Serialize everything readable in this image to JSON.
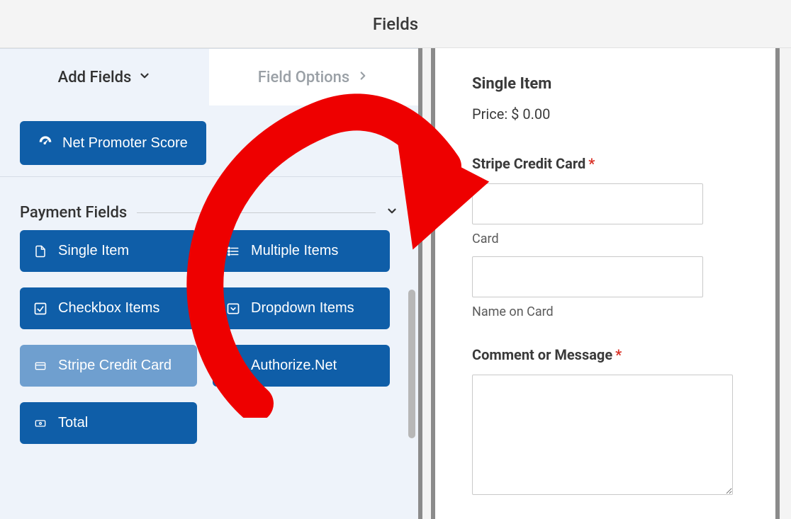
{
  "header": {
    "title": "Fields"
  },
  "tabs": {
    "add_fields": "Add Fields",
    "field_options": "Field Options"
  },
  "top_button": {
    "label": "Net Promoter Score"
  },
  "section": {
    "title": "Payment Fields"
  },
  "payment_fields": {
    "single_item": "Single Item",
    "multiple_items": "Multiple Items",
    "checkbox_items": "Checkbox Items",
    "dropdown_items": "Dropdown Items",
    "stripe_credit_card": "Stripe Credit Card",
    "authorize_net": "Authorize.Net",
    "total": "Total"
  },
  "preview": {
    "item_title": "Single Item",
    "price_label": "Price: $ 0.00",
    "stripe_label": "Stripe Credit Card",
    "card_sub": "Card",
    "name_sub": "Name on Card",
    "comment_label": "Comment or Message"
  },
  "colors": {
    "accent": "#0f5ea8",
    "panel": "#eef3fa",
    "arrow": "#ee0000"
  }
}
